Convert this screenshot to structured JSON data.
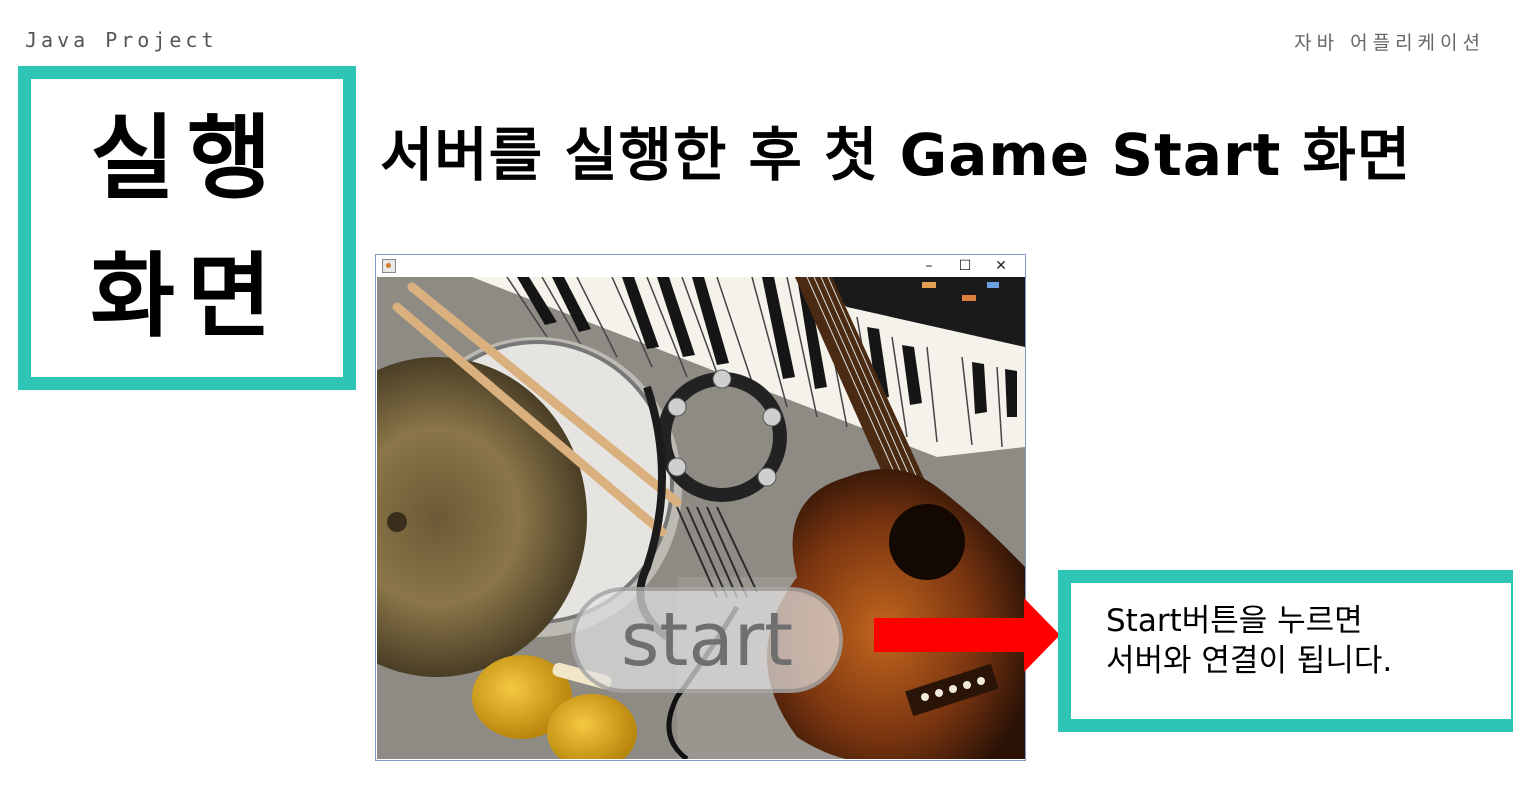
{
  "header": {
    "left_label": "Java Project",
    "right_label": "자바 어플리케이션"
  },
  "title_box": {
    "line1": "실행",
    "line2": "화면"
  },
  "headline": "서버를 실행한 후 첫 Game Start 화면",
  "app_window": {
    "controls": {
      "minimize": "–",
      "maximize": "☐",
      "close": "✕"
    },
    "start_button_label": "start"
  },
  "annotation": {
    "line1": "Start버튼을 누르면",
    "line2": "서버와 연결이 됩니다."
  },
  "colors": {
    "accent": "#2ec4b6",
    "arrow": "#ff0000"
  }
}
